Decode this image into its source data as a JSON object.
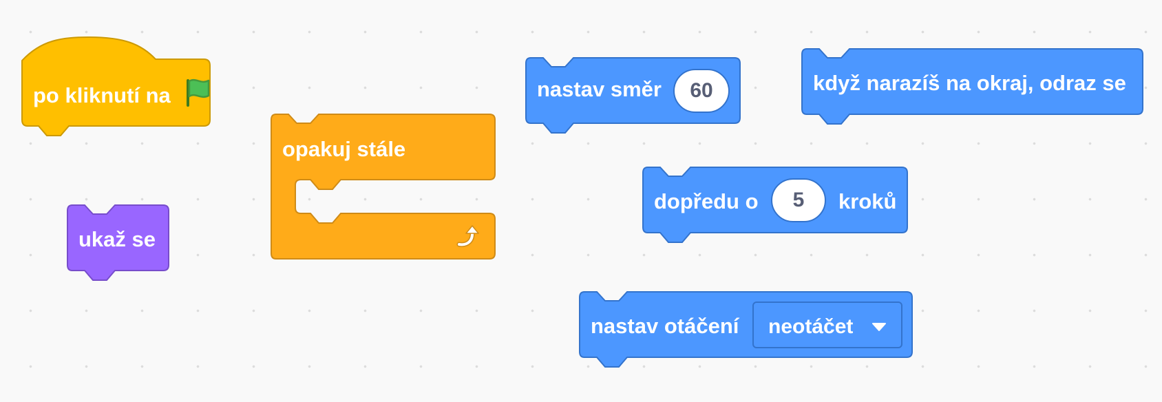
{
  "blocks": {
    "when_flag": {
      "label": "po kliknutí na",
      "icon": "green-flag-icon",
      "color": "#ffbf00",
      "border": "#cc9900"
    },
    "show": {
      "label": "ukaž se",
      "color": "#9966ff",
      "border": "#774dcb"
    },
    "forever": {
      "label": "opakuj stále",
      "icon": "loop-arrow-icon",
      "color": "#ffab19",
      "border": "#cf8b17"
    },
    "point_in_direction": {
      "label": "nastav směr",
      "value": "60",
      "color": "#4c97ff",
      "border": "#3373cc"
    },
    "bounce": {
      "label": "když narazíš na okraj, odraz se",
      "color": "#4c97ff",
      "border": "#3373cc"
    },
    "move_steps": {
      "label_before": "dopředu o",
      "value": "5",
      "label_after": "kroků",
      "color": "#4c97ff",
      "border": "#3373cc"
    },
    "rotation_style": {
      "label": "nastav otáčení",
      "selected": "neotáčet",
      "icon": "dropdown-arrow-icon",
      "color": "#4c97ff",
      "border": "#3373cc"
    }
  }
}
